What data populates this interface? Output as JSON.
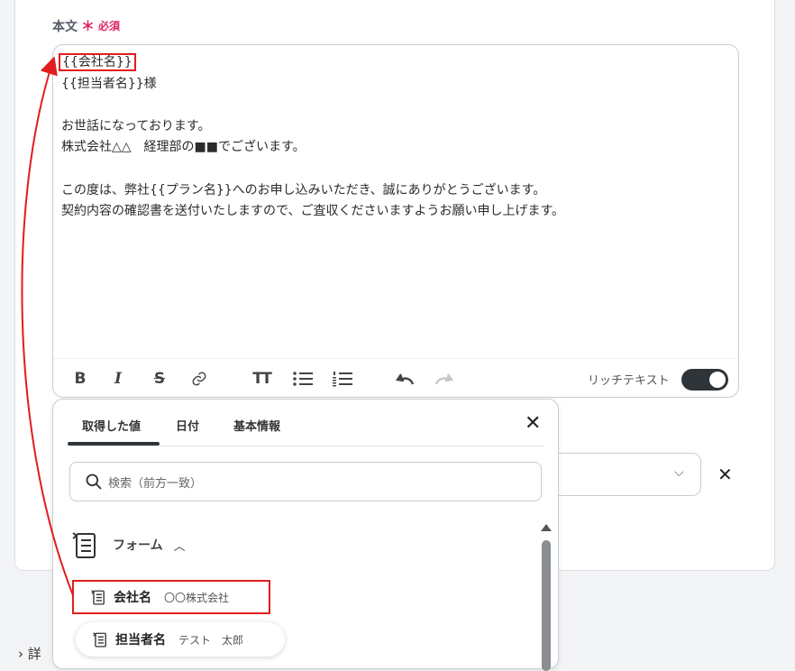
{
  "field": {
    "label": "本文",
    "required_mark": "＊",
    "required_text": "必須"
  },
  "editor": {
    "lines": [
      "{{会社名}}",
      "{{担当者名}}様",
      "",
      "お世話になっております。",
      "株式会社△△　経理部の■■でございます。",
      "",
      "この度は、弊社{{プラン名}}へのお申し込みいただき、誠にありがとうございます。",
      "契約内容の確認書を送付いたしますので、ご査収くださいますようお願い申し上げます。"
    ],
    "toolbar": {
      "bold": "B",
      "italic": "I",
      "strike": "S",
      "heading": "TT",
      "rich_text_label": "リッチテキスト",
      "rich_text_on": true
    }
  },
  "popup": {
    "tabs": [
      "取得した値",
      "日付",
      "基本情報"
    ],
    "active_tab": 0,
    "search_placeholder": "検索（前方一致）",
    "section_label": "フォーム",
    "items": [
      {
        "name": "会社名",
        "value": "〇〇株式会社"
      },
      {
        "name": "担当者名",
        "value": "テスト　太郎"
      }
    ]
  },
  "detail_toggle": "詳",
  "colors": {
    "required": "#e0245e",
    "annotation_red": "#e11d1d",
    "toggle_on": "#2f3438"
  }
}
